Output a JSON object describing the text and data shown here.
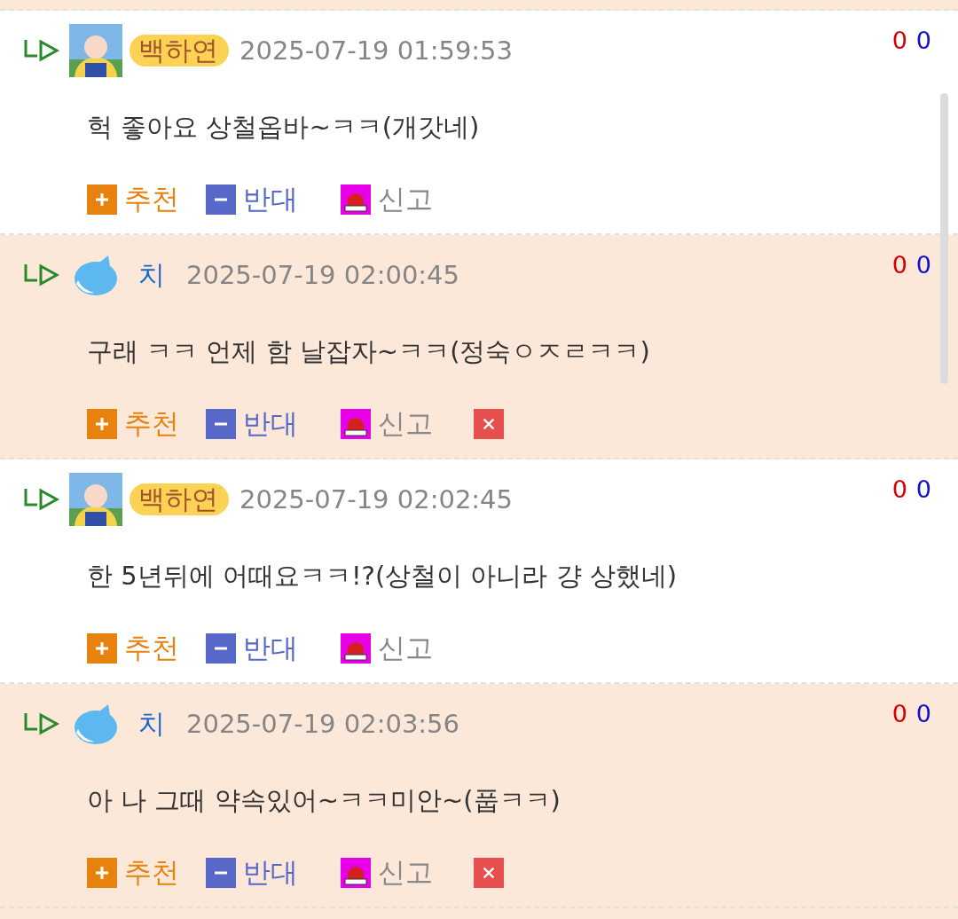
{
  "comments": [
    {
      "shaded": false,
      "avatar": {
        "kind": "portrait"
      },
      "name": "백하연",
      "kind": "writer",
      "highlighted": true,
      "time": "2025-07-19 01:59:53",
      "text": "헉 좋아요 상철옵바~ㅋㅋ(개갓네)",
      "up": "0",
      "down": "0",
      "actions": [
        "추천",
        "반대",
        "신고"
      ],
      "deletable": false
    },
    {
      "shaded": true,
      "avatar": {
        "kind": "mascot"
      },
      "name": "치",
      "kind": "member",
      "highlighted": false,
      "time": "2025-07-19 02:00:45",
      "text": "구래 ㅋㅋ 언제 함 날잡자~ㅋㅋ(정숙ㅇㅈㄹㅋㅋ)",
      "up": "0",
      "down": "0",
      "actions": [
        "추천",
        "반대",
        "신고"
      ],
      "deletable": true
    },
    {
      "shaded": false,
      "avatar": {
        "kind": "portrait"
      },
      "name": "백하연",
      "kind": "writer",
      "highlighted": true,
      "time": "2025-07-19 02:02:45",
      "text": "한 5년뒤에 어때요ㅋㅋ!?(상철이 아니라 걍 상했네)",
      "up": "0",
      "down": "0",
      "actions": [
        "추천",
        "반대",
        "신고"
      ],
      "deletable": false
    },
    {
      "shaded": true,
      "avatar": {
        "kind": "mascot"
      },
      "name": "치",
      "kind": "member",
      "highlighted": false,
      "time": "2025-07-19 02:03:56",
      "text": "아 나 그때 약속있어~ㅋㅋ미안~(풉ㅋㅋ)",
      "up": "0",
      "down": "0",
      "actions": [
        "추천",
        "반대",
        "신고"
      ],
      "deletable": true
    }
  ]
}
